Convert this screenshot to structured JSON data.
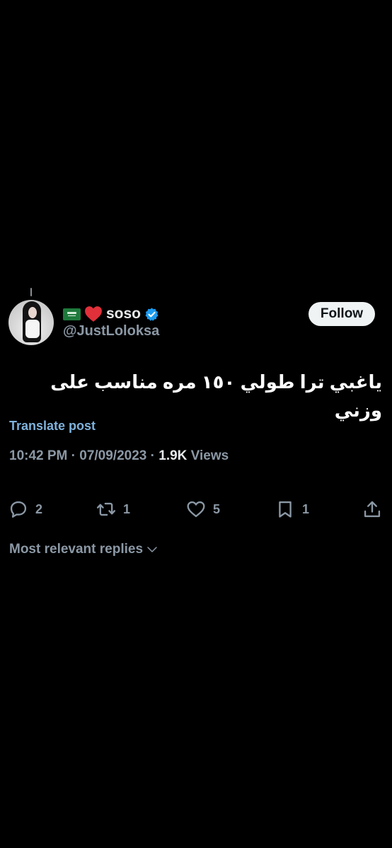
{
  "author": {
    "display_name": "soso",
    "handle": "@JustLoloksa",
    "name_emojis": [
      "saudi-flag-icon",
      "red-heart-icon"
    ],
    "verified": true
  },
  "follow_button": {
    "label": "Follow"
  },
  "tweet": {
    "text": "ياغبي ترا طولي ١٥٠ مره مناسب على وزني",
    "translate_label": "Translate post",
    "time": "10:42 PM",
    "date": "07/09/2023",
    "views_count": "1.9K",
    "views_label": "Views",
    "separator": "·"
  },
  "actions": {
    "replies": "2",
    "reposts": "1",
    "likes": "5",
    "bookmarks": "1"
  },
  "replies_sort": {
    "label": "Most relevant replies"
  },
  "colors": {
    "background": "#000000",
    "primary_text": "#e7e9ea",
    "secondary_text": "#8b98a5",
    "link": "#7fb2dc",
    "verified": "#1d9bf0",
    "heart": "#e0303a"
  }
}
